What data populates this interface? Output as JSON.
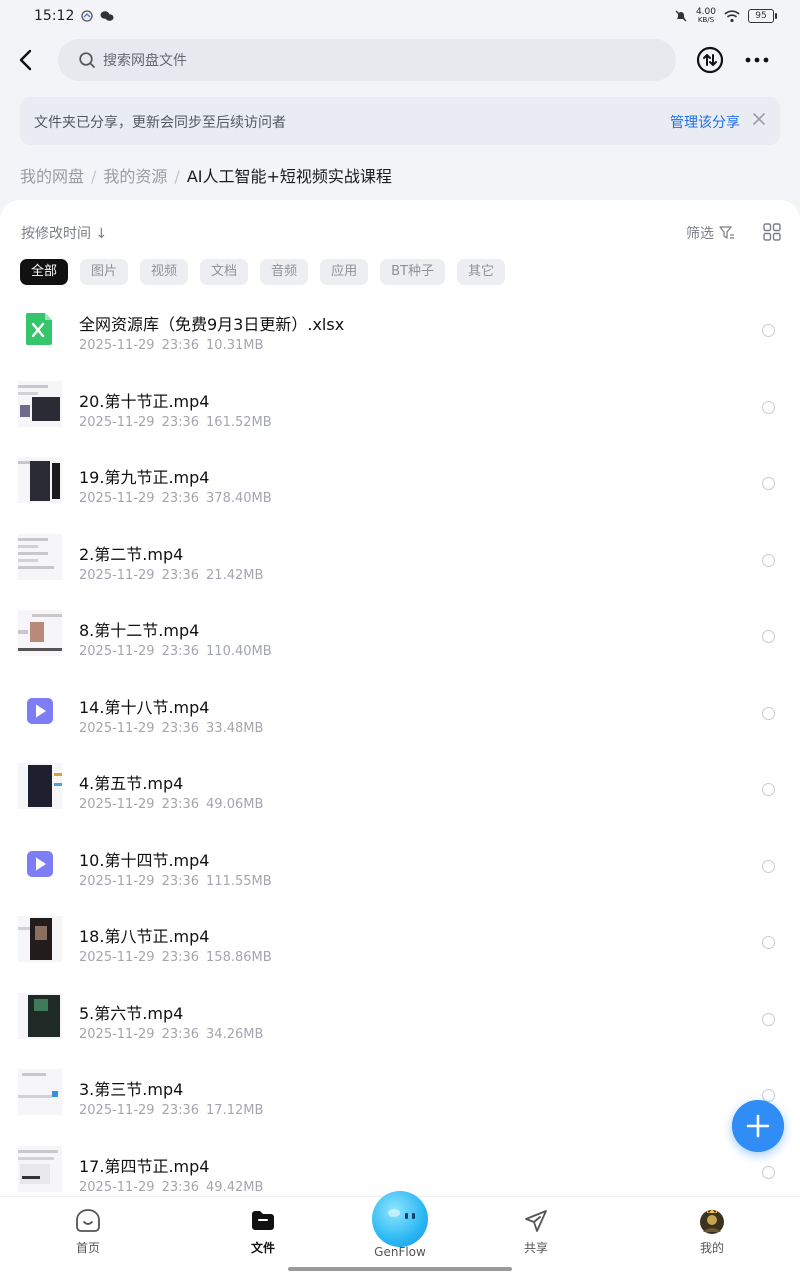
{
  "status_bar": {
    "time": "15:12",
    "speed_value": "4.00",
    "speed_unit": "KB/S",
    "battery": "95"
  },
  "topbar": {
    "search_placeholder": "搜索网盘文件"
  },
  "banner": {
    "text": "文件夹已分享，更新会同步至后续访问者",
    "link": "管理该分享"
  },
  "breadcrumb": {
    "items": [
      "我的网盘",
      "我的资源"
    ],
    "current": "AI人工智能+短视频实战课程",
    "separator": "/"
  },
  "toolbar": {
    "sort_label": "按修改时间 ↓",
    "filter_label": "筛选"
  },
  "chips": [
    "全部",
    "图片",
    "视频",
    "文档",
    "音频",
    "应用",
    "BT种子",
    "其它"
  ],
  "files": [
    {
      "name": "全网资源库（免费9月3日更新）.xlsx",
      "date": "2025-11-29",
      "time": "23:36",
      "size": "10.31MB",
      "icon": "excel-icon"
    },
    {
      "name": "20.第十节正.mp4",
      "date": "2025-11-29",
      "time": "23:36",
      "size": "161.52MB",
      "icon": "video-thumbnail"
    },
    {
      "name": "19.第九节正.mp4",
      "date": "2025-11-29",
      "time": "23:36",
      "size": "378.40MB",
      "icon": "video-thumbnail"
    },
    {
      "name": "2.第二节.mp4",
      "date": "2025-11-29",
      "time": "23:36",
      "size": "21.42MB",
      "icon": "video-thumbnail"
    },
    {
      "name": "8.第十二节.mp4",
      "date": "2025-11-29",
      "time": "23:36",
      "size": "110.40MB",
      "icon": "video-thumbnail"
    },
    {
      "name": "14.第十八节.mp4",
      "date": "2025-11-29",
      "time": "23:36",
      "size": "33.48MB",
      "icon": "video-play-icon"
    },
    {
      "name": "4.第五节.mp4",
      "date": "2025-11-29",
      "time": "23:36",
      "size": "49.06MB",
      "icon": "video-thumbnail"
    },
    {
      "name": "10.第十四节.mp4",
      "date": "2025-11-29",
      "time": "23:36",
      "size": "111.55MB",
      "icon": "video-play-icon"
    },
    {
      "name": "18.第八节正.mp4",
      "date": "2025-11-29",
      "time": "23:36",
      "size": "158.86MB",
      "icon": "video-thumbnail"
    },
    {
      "name": "5.第六节.mp4",
      "date": "2025-11-29",
      "time": "23:36",
      "size": "34.26MB",
      "icon": "video-thumbnail"
    },
    {
      "name": "3.第三节.mp4",
      "date": "2025-11-29",
      "time": "23:36",
      "size": "17.12MB",
      "icon": "video-thumbnail"
    },
    {
      "name": "17.第四节正.mp4",
      "date": "2025-11-29",
      "time": "23:36",
      "size": "49.42MB",
      "icon": "video-thumbnail"
    }
  ],
  "bottom_nav": [
    {
      "label": "首页",
      "icon": "home-icon"
    },
    {
      "label": "文件",
      "icon": "folder-icon"
    },
    {
      "label": "GenFlow",
      "icon": "genflow-icon"
    },
    {
      "label": "共享",
      "icon": "share-icon"
    },
    {
      "label": "我的",
      "icon": "avatar"
    }
  ],
  "colors": {
    "accent": "#1f6fe8",
    "fab": "#2f8df5",
    "active_chip": "#111111",
    "excel": "#35c56b",
    "video": "#7d7ef5"
  }
}
